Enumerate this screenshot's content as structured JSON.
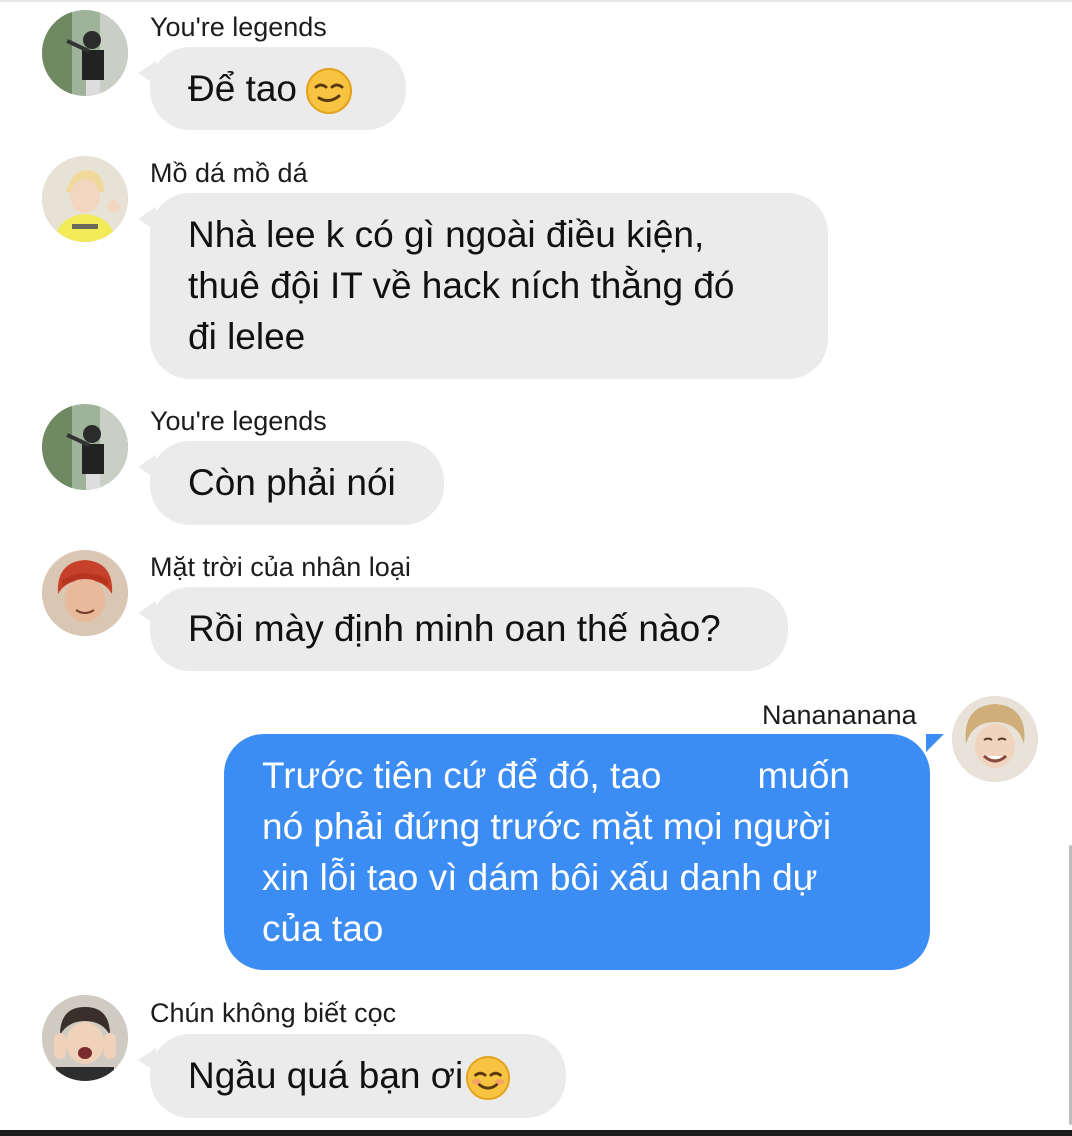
{
  "messages": [
    {
      "sender": "You're legends",
      "lines": [
        "Để tao"
      ],
      "emoji": "smirk-emoji"
    },
    {
      "sender": "Mồ dá mồ dá",
      "lines": [
        "Nhà lee k có gì ngoài điều kiện,",
        "thuê đội IT về hack ních thằng đó",
        "đi lelee"
      ]
    },
    {
      "sender": "You're legends",
      "lines": [
        "Còn phải nói"
      ]
    },
    {
      "sender": "Mặt trời của nhân loại",
      "lines": [
        "Rồi mày định minh oan thế nào?"
      ]
    },
    {
      "sender": "Nanananana",
      "lines_first_a": "Trước tiên cứ để đó, tao",
      "lines_first_b": "muốn",
      "lines": [
        "nó phải đứng trước mặt mọi người",
        "xin lỗi tao vì dám bôi xấu danh dự",
        "của tao"
      ],
      "outgoing": true
    },
    {
      "sender": "Chún không biết cọc",
      "lines": [
        "Ngầu quá bạn ơi"
      ],
      "emoji": "smiling-blush-emoji"
    }
  ],
  "colors": {
    "incoming_bubble": "#ebebeb",
    "outgoing_bubble": "#3b8cf3",
    "background": "#ffffff"
  }
}
